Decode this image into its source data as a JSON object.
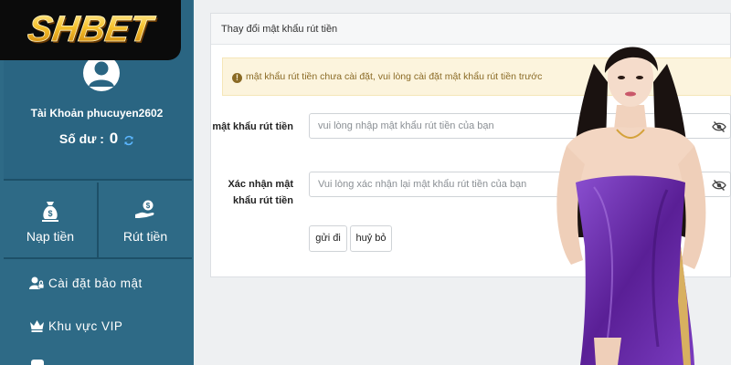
{
  "brand": {
    "logo_text": "SHBET"
  },
  "sidebar": {
    "account_label": "Tài Khoản phucuyen2602",
    "balance_label": "Số dư :",
    "balance_value": "0",
    "actions": [
      {
        "label": "Nạp tiền",
        "icon": "money-bag-icon"
      },
      {
        "label": "Rút tiền",
        "icon": "hand-money-icon"
      }
    ],
    "menu": [
      {
        "label": "Cài đặt bảo mật",
        "icon": "user-lock-icon"
      },
      {
        "label": "Khu vực VIP",
        "icon": "crown-icon"
      }
    ]
  },
  "panel": {
    "title": "Thay đổi mật khẩu rút tiền",
    "alert": "mật khẩu rút tiền chưa cài đặt, vui lòng cài đặt mật khẩu rút tiền trước",
    "fields": [
      {
        "label": "mật khẩu rút tiền",
        "placeholder": "vui lòng nhập mật khẩu rút tiền của bạn",
        "value": ""
      },
      {
        "label": "Xác nhận mật khẩu rút tiền",
        "placeholder": "Vui lòng xác nhận lại mật khẩu rút tiền của bạn",
        "value": ""
      }
    ],
    "submit_label": "gửi đi",
    "cancel_label": "huỷ bỏ"
  },
  "colors": {
    "sidebar_bg": "#2e6a86",
    "logo_gold": "#f5b21a",
    "alert_bg": "#fcf4dd",
    "dress_purple": "#6a2ba6"
  }
}
